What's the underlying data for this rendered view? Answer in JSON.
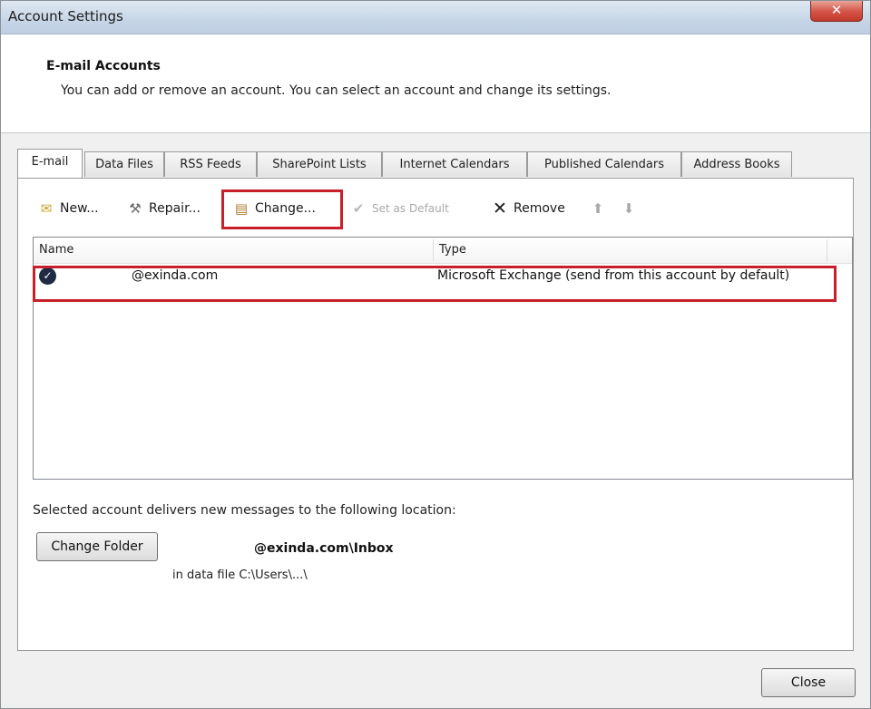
{
  "window": {
    "title": "Account Settings",
    "close_glyph": "✕"
  },
  "header": {
    "title": "E-mail Accounts",
    "description": "You can add or remove an account. You can select an account and change its settings."
  },
  "tabs": [
    "E-mail",
    "Data Files",
    "RSS Feeds",
    "SharePoint Lists",
    "Internet Calendars",
    "Published Calendars",
    "Address Books"
  ],
  "active_tab": "E-mail",
  "toolbar": {
    "new": "New...",
    "repair": "Repair...",
    "change": "Change...",
    "set_default": "Set as Default",
    "remove": "Remove"
  },
  "list": {
    "columns": {
      "name": "Name",
      "type": "Type"
    },
    "rows": [
      {
        "email": "@exinda.com",
        "type": "Microsoft Exchange (send from this account by default)",
        "default": true
      }
    ]
  },
  "location": {
    "label": "Selected account delivers new messages to the following location:",
    "change_folder": "Change Folder",
    "path": "@exinda.com\\Inbox",
    "data_file": "in data file C:\\Users\\...\\"
  },
  "footer": {
    "close": "Close"
  },
  "colors": {
    "highlight": "#c8202a",
    "accent_check": "#1f2a44"
  }
}
